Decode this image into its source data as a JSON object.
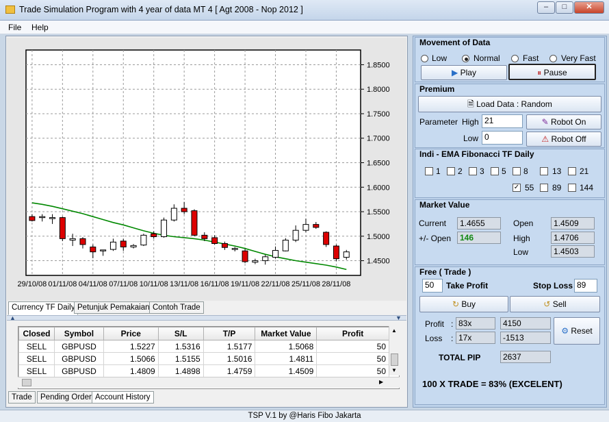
{
  "window": {
    "title": "Trade Simulation Program with 4 year of data  MT 4  [ Agt 2008 - Nop 2012 ]"
  },
  "menu": [
    "File",
    "Help"
  ],
  "chart_data": {
    "type": "candlestick",
    "ylim": [
      1.42,
      1.88
    ],
    "y_ticks": [
      "1.8500",
      "1.8000",
      "1.7500",
      "1.7000",
      "1.6500",
      "1.6000",
      "1.5500",
      "1.5000",
      "1.4500"
    ],
    "x_ticks": [
      "29/10/08",
      "01/11/08",
      "04/11/08",
      "07/11/08",
      "10/11/08",
      "13/11/08",
      "16/11/08",
      "19/11/08",
      "22/11/08",
      "25/11/08",
      "28/11/08"
    ],
    "candles": [
      {
        "o": 1.54,
        "h": 1.545,
        "l": 1.53,
        "c": 1.532,
        "dir": "down"
      },
      {
        "o": 1.538,
        "h": 1.545,
        "l": 1.53,
        "c": 1.54,
        "dir": "up"
      },
      {
        "o": 1.537,
        "h": 1.545,
        "l": 1.525,
        "c": 1.538,
        "dir": "up"
      },
      {
        "o": 1.538,
        "h": 1.54,
        "l": 1.49,
        "c": 1.495,
        "dir": "down"
      },
      {
        "o": 1.492,
        "h": 1.505,
        "l": 1.48,
        "c": 1.495,
        "dir": "up"
      },
      {
        "o": 1.495,
        "h": 1.498,
        "l": 1.475,
        "c": 1.483,
        "dir": "down"
      },
      {
        "o": 1.478,
        "h": 1.483,
        "l": 1.455,
        "c": 1.468,
        "dir": "down"
      },
      {
        "o": 1.47,
        "h": 1.472,
        "l": 1.46,
        "c": 1.472,
        "dir": "up"
      },
      {
        "o": 1.473,
        "h": 1.495,
        "l": 1.47,
        "c": 1.488,
        "dir": "up"
      },
      {
        "o": 1.49,
        "h": 1.495,
        "l": 1.47,
        "c": 1.478,
        "dir": "down"
      },
      {
        "o": 1.478,
        "h": 1.484,
        "l": 1.475,
        "c": 1.481,
        "dir": "up"
      },
      {
        "o": 1.482,
        "h": 1.505,
        "l": 1.48,
        "c": 1.502,
        "dir": "up"
      },
      {
        "o": 1.505,
        "h": 1.51,
        "l": 1.495,
        "c": 1.499,
        "dir": "down"
      },
      {
        "o": 1.499,
        "h": 1.538,
        "l": 1.497,
        "c": 1.533,
        "dir": "up"
      },
      {
        "o": 1.533,
        "h": 1.565,
        "l": 1.53,
        "c": 1.557,
        "dir": "up"
      },
      {
        "o": 1.557,
        "h": 1.57,
        "l": 1.545,
        "c": 1.55,
        "dir": "down"
      },
      {
        "o": 1.552,
        "h": 1.555,
        "l": 1.5,
        "c": 1.502,
        "dir": "down"
      },
      {
        "o": 1.502,
        "h": 1.508,
        "l": 1.49,
        "c": 1.495,
        "dir": "down"
      },
      {
        "o": 1.497,
        "h": 1.502,
        "l": 1.483,
        "c": 1.485,
        "dir": "down"
      },
      {
        "o": 1.485,
        "h": 1.489,
        "l": 1.472,
        "c": 1.477,
        "dir": "down"
      },
      {
        "o": 1.474,
        "h": 1.478,
        "l": 1.469,
        "c": 1.475,
        "dir": "up"
      },
      {
        "o": 1.47,
        "h": 1.474,
        "l": 1.445,
        "c": 1.448,
        "dir": "down"
      },
      {
        "o": 1.447,
        "h": 1.454,
        "l": 1.443,
        "c": 1.45,
        "dir": "up"
      },
      {
        "o": 1.45,
        "h": 1.462,
        "l": 1.442,
        "c": 1.458,
        "dir": "up"
      },
      {
        "o": 1.457,
        "h": 1.479,
        "l": 1.454,
        "c": 1.471,
        "dir": "up"
      },
      {
        "o": 1.47,
        "h": 1.496,
        "l": 1.469,
        "c": 1.492,
        "dir": "up"
      },
      {
        "o": 1.492,
        "h": 1.522,
        "l": 1.488,
        "c": 1.512,
        "dir": "up"
      },
      {
        "o": 1.512,
        "h": 1.536,
        "l": 1.508,
        "c": 1.524,
        "dir": "up"
      },
      {
        "o": 1.524,
        "h": 1.529,
        "l": 1.515,
        "c": 1.518,
        "dir": "down"
      },
      {
        "o": 1.508,
        "h": 1.51,
        "l": 1.478,
        "c": 1.483,
        "dir": "down"
      },
      {
        "o": 1.48,
        "h": 1.483,
        "l": 1.449,
        "c": 1.454,
        "dir": "down"
      },
      {
        "o": 1.457,
        "h": 1.472,
        "l": 1.452,
        "c": 1.468,
        "dir": "up"
      }
    ],
    "ma": [
      1.568,
      1.565,
      1.561,
      1.556,
      1.551,
      1.546,
      1.54,
      1.534,
      1.528,
      1.523,
      1.517,
      1.511,
      1.506,
      1.502,
      1.499,
      1.497,
      1.495,
      1.492,
      1.488,
      1.484,
      1.48,
      1.475,
      1.469,
      1.463,
      1.458,
      1.454,
      1.45,
      1.447,
      1.444,
      1.441,
      1.437,
      1.432
    ],
    "colors": {
      "up": "#ffffff",
      "down": "#dd0000",
      "ma": "#008800",
      "grid": "#9a9a9a",
      "bg": "#ffffff"
    }
  },
  "chart_tabs": [
    "Currency TF Daily",
    "Petunjuk Pemakaian",
    "Contoh Trade"
  ],
  "history": {
    "columns": [
      "Closed",
      "Symbol",
      "Price",
      "S/L",
      "T/P",
      "Market Value",
      "Profit"
    ],
    "rows": [
      [
        "SELL",
        "GBPUSD",
        "1.5227",
        "1.5316",
        "1.5177",
        "1.5068",
        "50"
      ],
      [
        "SELL",
        "GBPUSD",
        "1.5066",
        "1.5155",
        "1.5016",
        "1.4811",
        "50"
      ],
      [
        "SELL",
        "GBPUSD",
        "1.4809",
        "1.4898",
        "1.4759",
        "1.4509",
        "50"
      ]
    ]
  },
  "bottom_tabs": [
    "Trade",
    "Pending Order",
    "Account History"
  ],
  "movement": {
    "title": "Movement of Data",
    "speeds": [
      "Low",
      "Normal",
      "Fast",
      "Very Fast"
    ],
    "selected": "Normal",
    "play_label": "Play",
    "pause_label": "Pause"
  },
  "premium": {
    "title": "Premium",
    "load_label": "Load Data  : Random",
    "parameter_label": "Parameter",
    "high_label": "High",
    "high_value": "21",
    "low_label": "Low",
    "low_value": "0",
    "robot_on_label": "Robot On",
    "robot_off_label": "Robot Off"
  },
  "indi": {
    "title": "Indi - EMA Fibonacci  TF Daily",
    "row1": [
      "1",
      "2",
      "3",
      "5",
      "8",
      "13",
      "21"
    ],
    "row2": [
      "55",
      "89",
      "144"
    ],
    "checked": [
      "55"
    ]
  },
  "market": {
    "title": "Market Value",
    "current_label": "Current",
    "current_value": "1.4655",
    "change_label": "+/- Open",
    "change_value": "146",
    "open_label": "Open",
    "open_value": "1.4509",
    "high_label": "High",
    "high_value": "1.4706",
    "low_label": "Low",
    "low_value": "1.4503"
  },
  "free": {
    "title": "Free ( Trade )",
    "tp_value": "50",
    "tp_label": "Take Profit",
    "sl_label": "Stop Loss",
    "sl_value": "89",
    "buy_label": "Buy",
    "sell_label": "Sell",
    "profit_label": "Profit",
    "profit_count": "83x",
    "profit_value": "4150",
    "loss_label": "Loss",
    "loss_count": "17x",
    "loss_value": "-1513",
    "reset_label": "Reset",
    "total_label": "TOTAL PIP",
    "total_value": "2637",
    "summary": "100 X TRADE = 83% (EXCELENT)"
  },
  "status": "TSP V.1 by @Haris Fibo Jakarta"
}
